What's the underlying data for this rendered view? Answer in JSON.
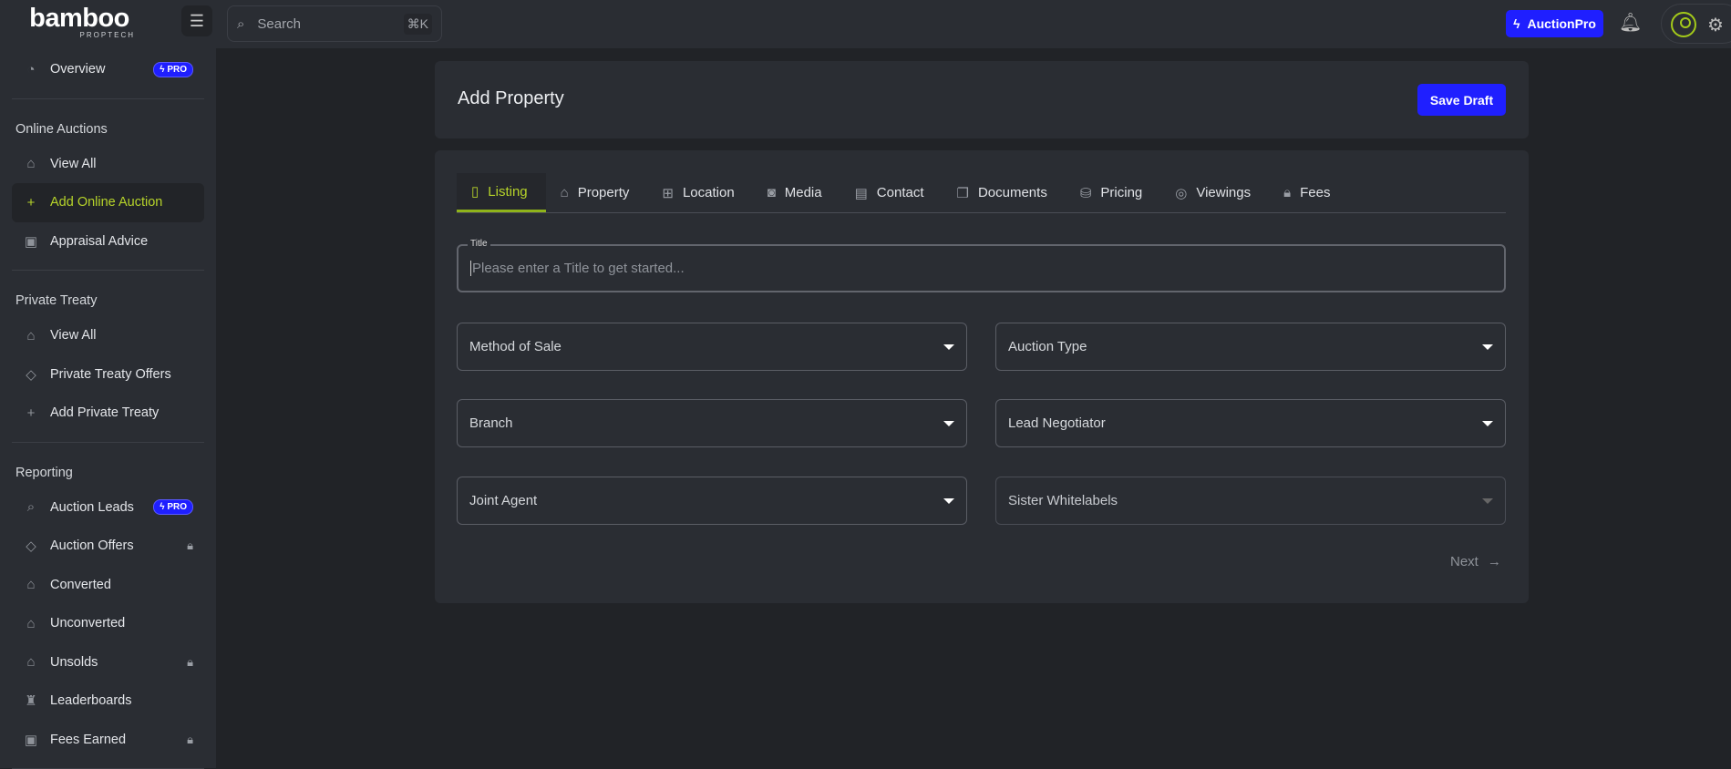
{
  "header": {
    "logo": "bamboo",
    "logo_sub": "PROPTECH",
    "search_placeholder": "Search",
    "search_shortcut": "⌘K",
    "auction_pro": "AuctionPro"
  },
  "sidebar": {
    "overview": "Overview",
    "pro_badge": "PRO",
    "sections": [
      {
        "title": "Online Auctions",
        "items": [
          "View All",
          "Add Online Auction",
          "Appraisal Advice"
        ]
      },
      {
        "title": "Private Treaty",
        "items": [
          "View All",
          "Private Treaty Offers",
          "Add Private Treaty"
        ]
      },
      {
        "title": "Reporting",
        "items": [
          "Auction Leads",
          "Auction Offers",
          "Converted",
          "Unconverted",
          "Unsolds",
          "Leaderboards",
          "Fees Earned"
        ]
      }
    ]
  },
  "page": {
    "title": "Add Property",
    "save_draft": "Save Draft"
  },
  "tabs": [
    "Listing",
    "Property",
    "Location",
    "Media",
    "Contact",
    "Documents",
    "Pricing",
    "Viewings",
    "Fees"
  ],
  "form": {
    "title_label": "Title",
    "title_placeholder": "Please enter a Title to get started...",
    "method_of_sale": "Method of Sale",
    "auction_type": "Auction Type",
    "branch": "Branch",
    "lead_negotiator": "Lead Negotiator",
    "joint_agent": "Joint Agent",
    "sister_whitelabels": "Sister Whitelabels",
    "next": "Next"
  },
  "colors": {
    "accent": "#b6d32a",
    "brand_blue": "#1f1fff"
  }
}
